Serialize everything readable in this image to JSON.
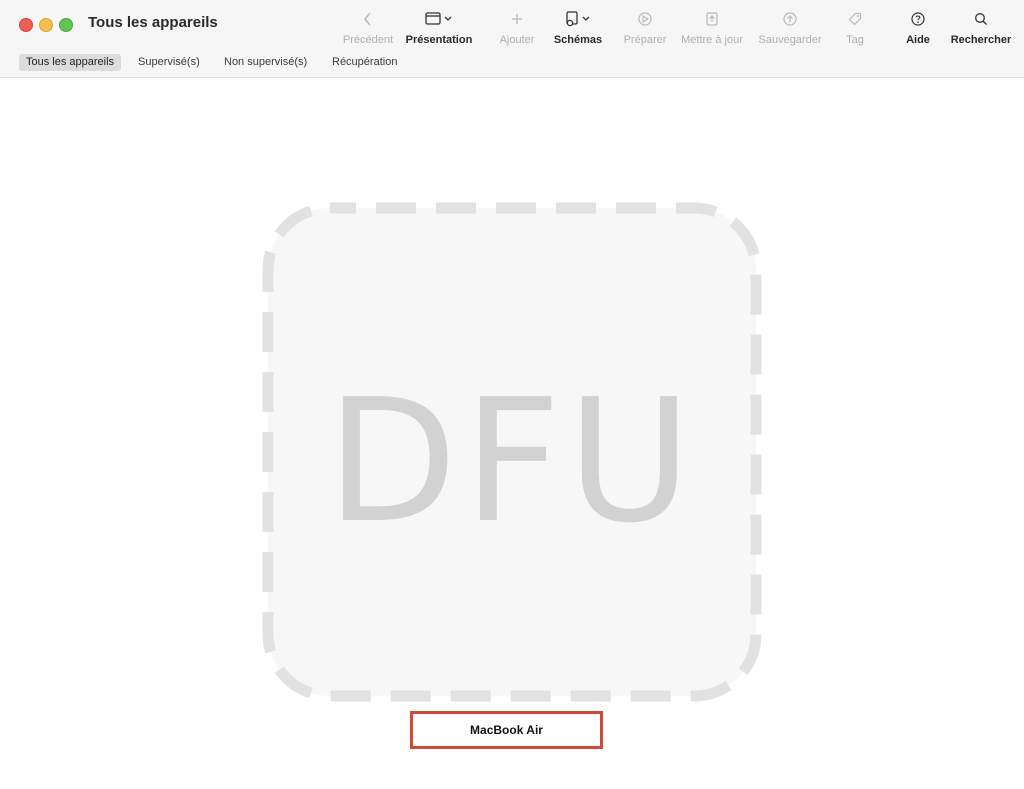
{
  "window": {
    "title": "Tous les appareils"
  },
  "toolbar": {
    "items": [
      {
        "label": "Précédent",
        "icon": "chevron-left-icon",
        "enabled": false
      },
      {
        "label": "Présentation",
        "icon": "window-view-icon",
        "enabled": true
      },
      {
        "label": "Ajouter",
        "icon": "plus-icon",
        "enabled": false
      },
      {
        "label": "Schémas",
        "icon": "blueprint-icon",
        "enabled": true
      },
      {
        "label": "Préparer",
        "icon": "prepare-icon",
        "enabled": false
      },
      {
        "label": "Mettre à jour",
        "icon": "update-icon",
        "enabled": false
      },
      {
        "label": "Sauvegarder",
        "icon": "backup-icon",
        "enabled": false
      },
      {
        "label": "Tag",
        "icon": "tag-icon",
        "enabled": false
      },
      {
        "label": "Aide",
        "icon": "help-icon",
        "enabled": true
      },
      {
        "label": "Rechercher",
        "icon": "search-icon",
        "enabled": true
      }
    ]
  },
  "tabs": [
    {
      "label": "Tous les appareils",
      "active": true
    },
    {
      "label": "Supervisé(s)",
      "active": false
    },
    {
      "label": "Non supervisé(s)",
      "active": false
    },
    {
      "label": "Récupération",
      "active": false
    }
  ],
  "device": {
    "placeholder_text": "DFU",
    "name": "MacBook Air"
  },
  "colors": {
    "highlight_border": "#cf4b36",
    "dfu_frame": "#e2e2e2",
    "dfu_fill": "#f7f7f7"
  }
}
